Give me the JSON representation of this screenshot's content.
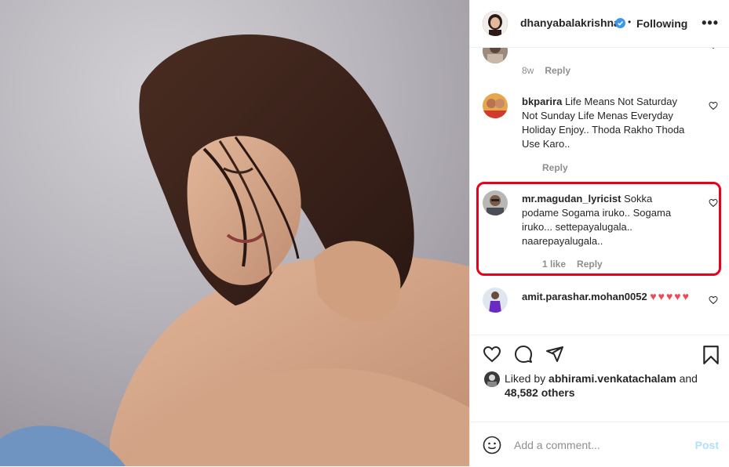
{
  "post": {
    "username": "dhanyabalakrishna",
    "follow_state": "Following",
    "separator": "•",
    "more_label": "•••"
  },
  "comments": [
    {
      "age": "8w",
      "reply": "Reply"
    },
    {
      "username": "bkparira",
      "text": "Life Means Not Saturday Not Sunday Life Menas Everyday Holiday Enjoy.. Thoda Rakho Thoda Use Karo..",
      "reply": "Reply"
    },
    {
      "username": "mr.magudan_lyricist",
      "text": "Sokka podame Sogama iruko.. Sogama iruko... settepayalugala.. naarepayalugala..",
      "likes": "1 like",
      "reply": "Reply"
    },
    {
      "username": "amit.parashar.mohan0052",
      "text": "♥♥♥♥♥"
    }
  ],
  "likes": {
    "prefix": "Liked by",
    "user": "abhirami.venkatachalam",
    "connector": "and",
    "count": "48,582 others"
  },
  "add_comment": {
    "placeholder": "Add a comment...",
    "post_label": "Post"
  },
  "colors": {
    "highlight": "#e8001c",
    "verified": "#3897f0",
    "post_disabled": "#b2dffc"
  },
  "icons": [
    "verified-badge-icon",
    "more-options-icon",
    "heart-icon",
    "comment-icon",
    "share-icon",
    "save-icon",
    "emoji-icon"
  ]
}
